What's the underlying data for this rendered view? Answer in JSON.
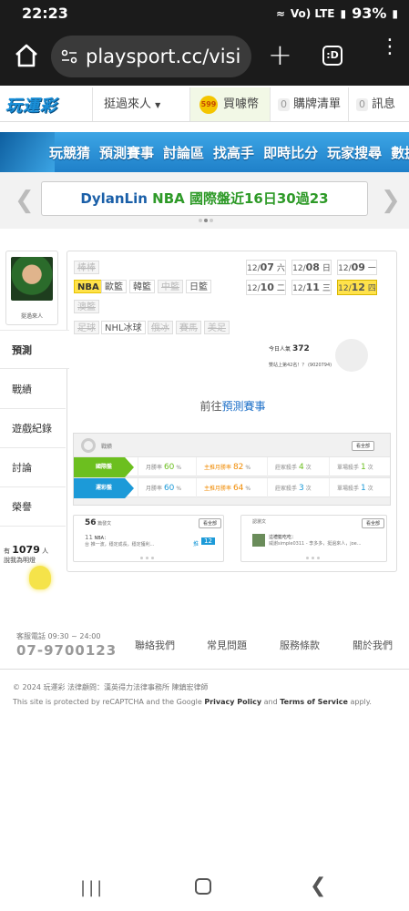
{
  "status_bar": {
    "time": "22:23",
    "network": "Vo) LTE",
    "battery": "93%"
  },
  "browser": {
    "url": "playsport.cc/visi",
    "tabs_count": ":D"
  },
  "site_nav": {
    "logo": "玩運彩",
    "user_menu": "挺過來人",
    "coin_icon_text": "599",
    "buy_coin": "買噱幣",
    "cart_count": "0",
    "cart": "購牌清單",
    "msg_count": "0",
    "messages": "訊息"
  },
  "main_menu": [
    "玩競猜",
    "預測賽事",
    "討論區",
    "找高手",
    "即時比分",
    "玩家搜尋",
    "數據"
  ],
  "banner": {
    "name": "DylanLin",
    "text": "NBA 國際盤近16日30過23"
  },
  "profile": {
    "name": "挺過來人"
  },
  "left_menu": [
    "預測",
    "戰績",
    "遊戲紀錄",
    "討論",
    "榮譽"
  ],
  "helpers": {
    "prefix": "有",
    "count": "1079",
    "unit": "人",
    "caption": "說我為明燈"
  },
  "sport_tags": [
    {
      "label": "棒棒",
      "state": "dim"
    },
    {
      "label": "NBA",
      "state": "on"
    },
    {
      "label": "歐籃",
      "state": "normal"
    },
    {
      "label": "韓籃",
      "state": "normal"
    },
    {
      "label": "中籃",
      "state": "dim"
    },
    {
      "label": "日籃",
      "state": "normal"
    },
    {
      "label": "澳籃",
      "state": "dim"
    },
    {
      "label": "足球",
      "state": "dim"
    },
    {
      "label": "NHL冰球",
      "state": "normal"
    },
    {
      "label": "俄冰",
      "state": "dim"
    },
    {
      "label": "賽馬",
      "state": "dim"
    },
    {
      "label": "美足",
      "state": "dim"
    }
  ],
  "dates": [
    {
      "md": "12/",
      "day": "07",
      "wd": "六",
      "on": false
    },
    {
      "md": "12/",
      "day": "08",
      "wd": "日",
      "on": false
    },
    {
      "md": "12/",
      "day": "09",
      "wd": "一",
      "on": false
    },
    {
      "md": "12/",
      "day": "10",
      "wd": "二",
      "on": false
    },
    {
      "md": "12/",
      "day": "11",
      "wd": "三",
      "on": false
    },
    {
      "md": "12/",
      "day": "12",
      "wd": "四",
      "on": true
    }
  ],
  "popularity": {
    "label": "今日人氣",
    "value": "372",
    "rank": "雙站上第42名！？ (9020794)"
  },
  "goto": {
    "prefix": "前往",
    "link": "預測賽事"
  },
  "stats": {
    "title": "戰績",
    "all_btn": "看全部",
    "rows": [
      {
        "label": "國際盤",
        "color": "#6cbf1f",
        "month_label": "月勝率",
        "month": "60",
        "main_label": "主推月勝率",
        "main": "82",
        "streak_label": "莊家殺手",
        "streak": "4",
        "single_label": "單場殺手",
        "single": "1",
        "unit_pct": "%",
        "unit_times": "次"
      },
      {
        "label": "運彩盤",
        "color": "#1c9ad8",
        "month_label": "月勝率",
        "month": "60",
        "main_label": "主推月勝率",
        "main": "64",
        "streak_label": "莊家殺手",
        "streak": "3",
        "single_label": "單場殺手",
        "single": "1",
        "unit_pct": "%",
        "unit_times": "次"
      }
    ]
  },
  "posts": {
    "count": "56",
    "title": "篇發文",
    "all_btn": "看全部",
    "item_num": "11",
    "item_title": "NBA：",
    "item_desc": "台 推一波，穩定成長，穩定獲利...",
    "badge_label": "推",
    "badge": "12"
  },
  "replies": {
    "title": "認瀏文",
    "all_btn": "看全部",
    "item_title": "這禮籃吃吃：",
    "item_desc": "威謝simple0311 - 李多多，挺過來人，joe..."
  },
  "footer": {
    "service_hours": "客服電話 09:30 ~ 24:00",
    "phone": "07-9700123",
    "links": [
      "聯絡我們",
      "常見問題",
      "服務條款",
      "關於我們"
    ],
    "copyright": "© 2024 玩運彩 法律顧問：漢英得力法律事務所 陳鎮宏律師",
    "recaptcha_pre": "This site is protected by reCAPTCHA and the Google",
    "privacy": "Privacy Policy",
    "and": "and",
    "terms": "Terms of Service",
    "apply": "apply."
  }
}
